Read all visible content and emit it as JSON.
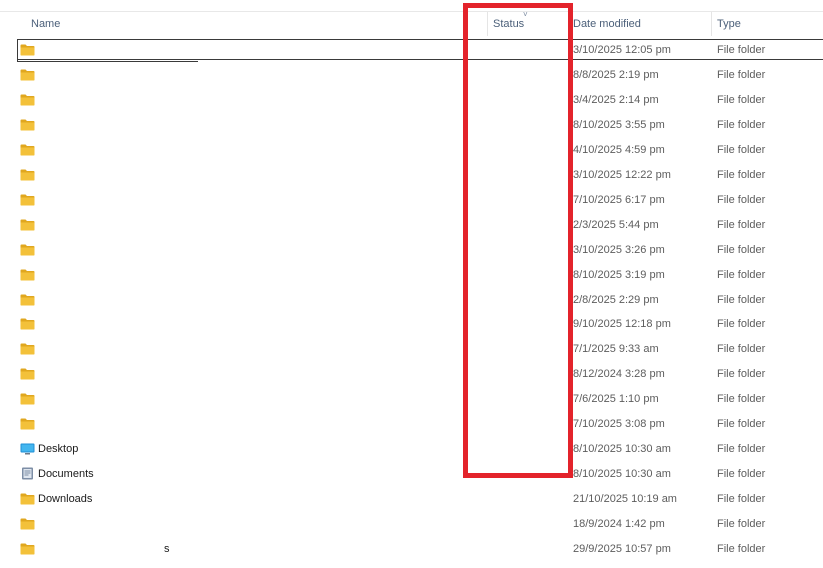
{
  "columns": {
    "name": "Name",
    "status": "Status",
    "date_modified": "Date modified",
    "type": "Type"
  },
  "colors": {
    "folder": "#f3c13a",
    "folder_dark": "#e0a71f",
    "highlight": "#e3232b"
  },
  "rows": [
    {
      "name": "",
      "date": "3/10/2025 12:05 pm",
      "type": "File folder",
      "icon": "folder-icon",
      "selected": true
    },
    {
      "name": "",
      "date": "8/8/2025 2:19 pm",
      "type": "File folder",
      "icon": "folder-icon"
    },
    {
      "name": "",
      "date": "3/4/2025 2:14 pm",
      "type": "File folder",
      "icon": "folder-icon"
    },
    {
      "name": "",
      "date": "8/10/2025 3:55 pm",
      "type": "File folder",
      "icon": "folder-icon"
    },
    {
      "name": "",
      "date": "4/10/2025 4:59 pm",
      "type": "File folder",
      "icon": "folder-icon"
    },
    {
      "name": "",
      "date": "3/10/2025 12:22 pm",
      "type": "File folder",
      "icon": "folder-icon"
    },
    {
      "name": "",
      "date": "7/10/2025 6:17 pm",
      "type": "File folder",
      "icon": "folder-icon"
    },
    {
      "name": "",
      "date": "2/3/2025 5:44 pm",
      "type": "File folder",
      "icon": "folder-icon"
    },
    {
      "name": "",
      "date": "3/10/2025 3:26 pm",
      "type": "File folder",
      "icon": "folder-icon"
    },
    {
      "name": "",
      "date": "8/10/2025 3:19 pm",
      "type": "File folder",
      "icon": "folder-icon"
    },
    {
      "name": "",
      "date": "2/8/2025 2:29 pm",
      "type": "File folder",
      "icon": "folder-icon"
    },
    {
      "name": "",
      "date": "9/10/2025 12:18 pm",
      "type": "File folder",
      "icon": "folder-icon"
    },
    {
      "name": "",
      "date": "7/1/2025 9:33 am",
      "type": "File folder",
      "icon": "folder-icon"
    },
    {
      "name": "",
      "date": "8/12/2024 3:28 pm",
      "type": "File folder",
      "icon": "folder-icon"
    },
    {
      "name": "",
      "date": "7/6/2025 1:10 pm",
      "type": "File folder",
      "icon": "folder-icon"
    },
    {
      "name": "",
      "date": "7/10/2025 3:08 pm",
      "type": "File folder",
      "icon": "folder-icon"
    },
    {
      "name": "Desktop",
      "date": "8/10/2025 10:30 am",
      "type": "File folder",
      "icon": "desktop-icon"
    },
    {
      "name": "Documents",
      "date": "8/10/2025 10:30 am",
      "type": "File folder",
      "icon": "documents-icon"
    },
    {
      "name": "Downloads",
      "date": "21/10/2025 10:19 am",
      "type": "File folder",
      "icon": "folder-icon"
    },
    {
      "name": "",
      "date": "18/9/2024 1:42 pm",
      "type": "File folder",
      "icon": "folder-icon"
    },
    {
      "name": "s",
      "date": "29/9/2025 10:57 pm",
      "type": "File folder",
      "icon": "folder-icon"
    }
  ]
}
